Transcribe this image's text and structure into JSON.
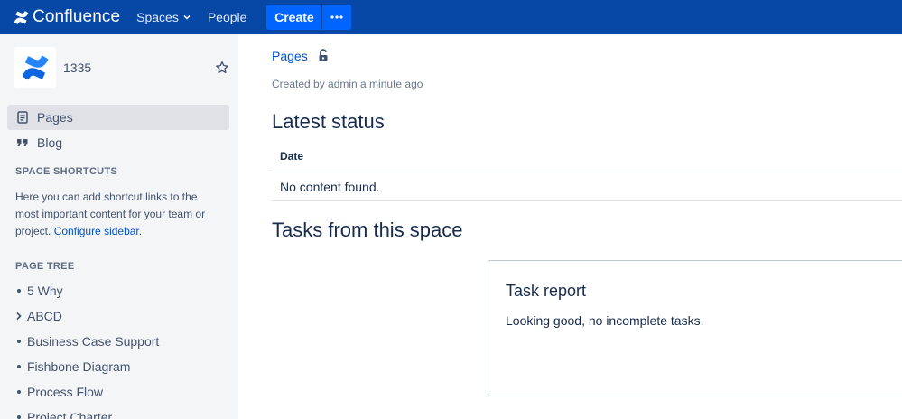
{
  "header": {
    "brand": "Confluence",
    "nav": {
      "spaces": "Spaces",
      "people": "People"
    },
    "create_label": "Create",
    "more_label": "⋯"
  },
  "sidebar": {
    "space_name": "1335",
    "nav_items": [
      {
        "label": "Pages",
        "icon": "page-icon",
        "active": true
      },
      {
        "label": "Blog",
        "icon": "quote-icon",
        "active": false
      }
    ],
    "shortcuts": {
      "heading": "SPACE SHORTCUTS",
      "text": "Here you can add shortcut links to the most important content for your team or project.",
      "link": "Configure sidebar",
      "after_link": "."
    },
    "tree": {
      "heading": "PAGE TREE",
      "items": [
        {
          "label": "5 Why",
          "marker": "bullet"
        },
        {
          "label": "ABCD",
          "marker": "chevron-right"
        },
        {
          "label": "Business Case Support",
          "marker": "bullet"
        },
        {
          "label": "Fishbone Diagram",
          "marker": "bullet"
        },
        {
          "label": "Process Flow",
          "marker": "bullet"
        },
        {
          "label": "Project Charter",
          "marker": "bullet"
        }
      ]
    }
  },
  "main": {
    "breadcrumb": "Pages",
    "byline": "Created by admin a minute ago",
    "latest_status": {
      "heading": "Latest status",
      "column": "Date",
      "empty": "No content found."
    },
    "tasks": {
      "heading": "Tasks from this space",
      "report_title": "Task report",
      "report_text": "Looking good, no incomplete tasks."
    }
  },
  "colors": {
    "header_bg": "#0747a6",
    "create_bg": "#0065ff",
    "sidebar_bg": "#f4f5f7",
    "link": "#0052cc",
    "text": "#172b4d"
  }
}
